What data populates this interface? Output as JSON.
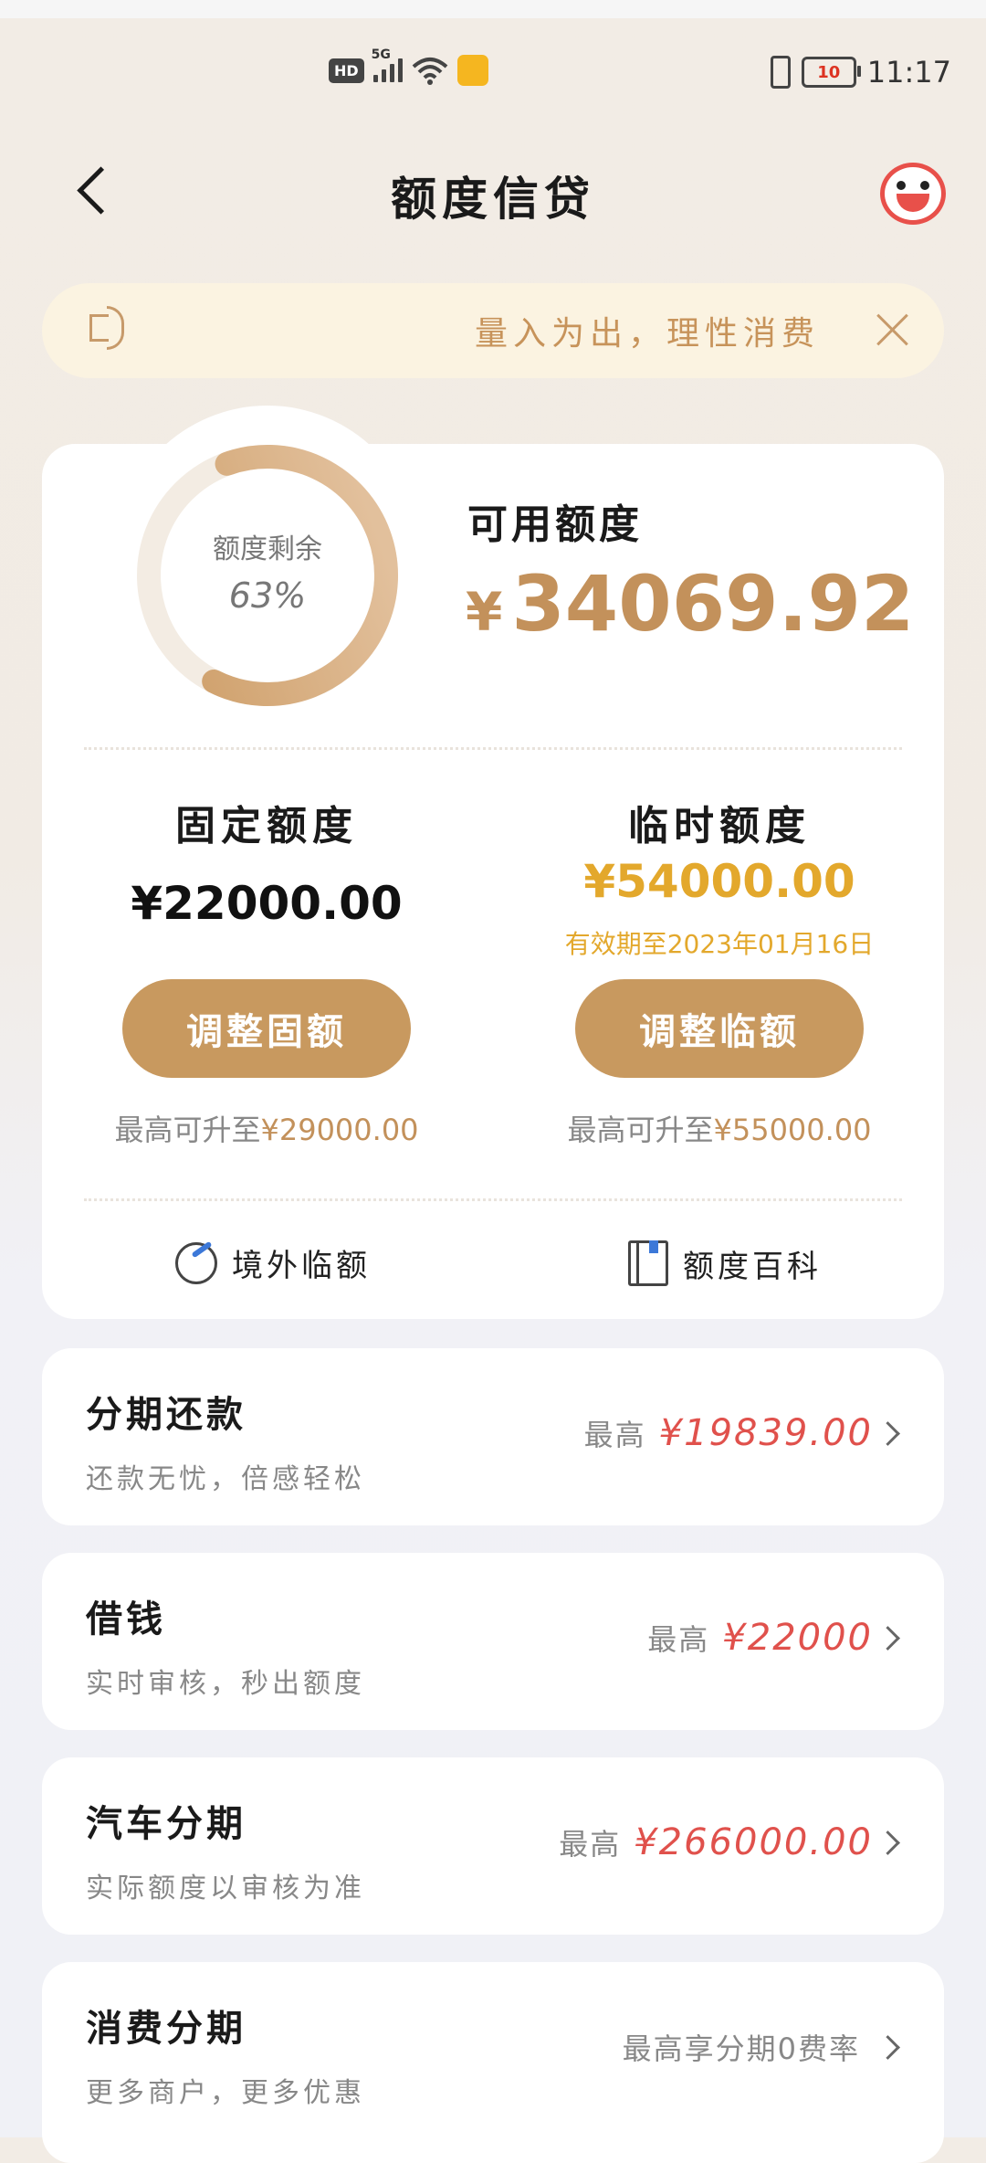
{
  "status_bar": {
    "hd": "HD",
    "network": "5G",
    "battery": "10",
    "time": "11:17"
  },
  "header": {
    "title": "额度信贷"
  },
  "notice": {
    "text": "量入为出，理性消费"
  },
  "credit": {
    "remaining_label": "额度剩余",
    "remaining_percent_text": "63%",
    "remaining_fraction": 0.63,
    "available_label": "可用额度",
    "available_amount": "34069.92",
    "yen": "¥",
    "fixed": {
      "title": "固定额度",
      "amount": "¥22000.00",
      "button": "调整固额",
      "max_prefix": "最高可升至",
      "max_value": "¥29000.00"
    },
    "temporary": {
      "title": "临时额度",
      "amount": "¥54000.00",
      "expiry": "有效期至2023年01月16日",
      "button": "调整临额",
      "max_prefix": "最高可升至",
      "max_value": "¥55000.00"
    },
    "links": [
      {
        "label": "境外临额",
        "icon": "plane-icon"
      },
      {
        "label": "额度百科",
        "icon": "book-icon"
      }
    ]
  },
  "services": [
    {
      "title": "分期还款",
      "subtitle": "还款无忧，倍感轻松",
      "prefix": "最高",
      "value": "¥19839.00"
    },
    {
      "title": "借钱",
      "subtitle": "实时审核，秒出额度",
      "prefix": "最高",
      "value": "¥22000"
    },
    {
      "title": "汽车分期",
      "subtitle": "实际额度以审核为准",
      "prefix": "最高",
      "value": "¥266000.00"
    },
    {
      "title": "消费分期",
      "subtitle": "更多商户，更多优惠",
      "prefix": "最高享分期0费率",
      "value": ""
    }
  ],
  "colors": {
    "accent": "#c8995f",
    "amount_gold": "#c3915b",
    "temp_yellow": "#e3a82c",
    "value_red": "#e0514c",
    "notice_bg": "#fbf3e1"
  }
}
